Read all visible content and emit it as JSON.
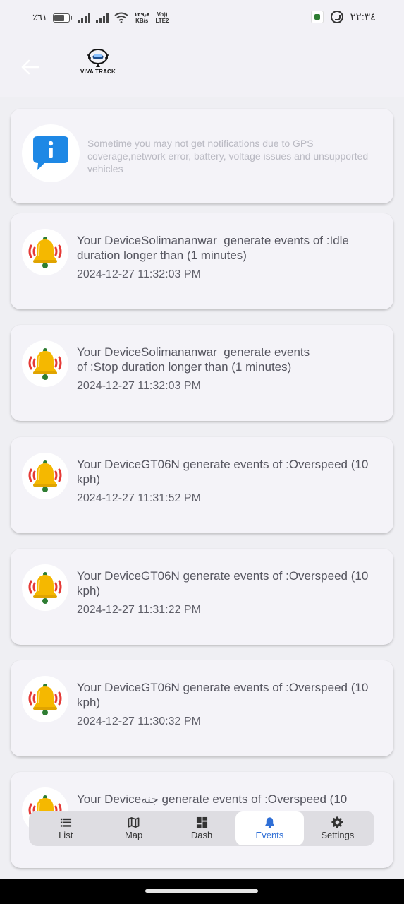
{
  "status_bar": {
    "battery": "٪٦١",
    "net_speed_value": "١٢٩٫٨",
    "net_speed_unit": "KB/s",
    "volte_top": "Vo))",
    "volte_bottom": "LTE2",
    "time": "٢٢:٣٤"
  },
  "header": {
    "logo_text": "VIVA TRACK"
  },
  "notice": {
    "text": "Sometime you may not get notifications due to GPS coverage,network error, battery, voltage issues and unsupported vehicles"
  },
  "events": [
    {
      "message": "Your DeviceSolimananwar  generate events of :Idle duration longer than (1 minutes)",
      "time": "2024-12-27 11:32:03 PM"
    },
    {
      "message": "Your DeviceSolimananwar  generate events\nof :Stop duration longer than (1 minutes)",
      "time": "2024-12-27 11:32:03 PM"
    },
    {
      "message": "Your DeviceGT06N generate events of :Overspeed (10 kph)",
      "time": "2024-12-27 11:31:52 PM"
    },
    {
      "message": "Your DeviceGT06N generate events of :Overspeed (10 kph)",
      "time": "2024-12-27 11:31:22 PM"
    },
    {
      "message": "Your DeviceGT06N generate events of :Overspeed (10 kph)",
      "time": "2024-12-27 11:30:32 PM"
    },
    {
      "message": "Your Deviceجنه generate events of :Overspeed (10",
      "time": ""
    }
  ],
  "nav": {
    "items": [
      {
        "label": "List",
        "icon": "list-icon"
      },
      {
        "label": "Map",
        "icon": "map-icon"
      },
      {
        "label": "Dash",
        "icon": "dashboard-icon"
      },
      {
        "label": "Events",
        "icon": "bell-icon",
        "active": true
      },
      {
        "label": "Settings",
        "icon": "gear-icon"
      }
    ],
    "active_color": "#2f6fd6"
  },
  "colors": {
    "background": "#f2f1f6",
    "card": "#f4f3f8",
    "info_blue": "#1e88e5",
    "bell_yellow": "#f5b800",
    "alert_red": "#e53935"
  }
}
